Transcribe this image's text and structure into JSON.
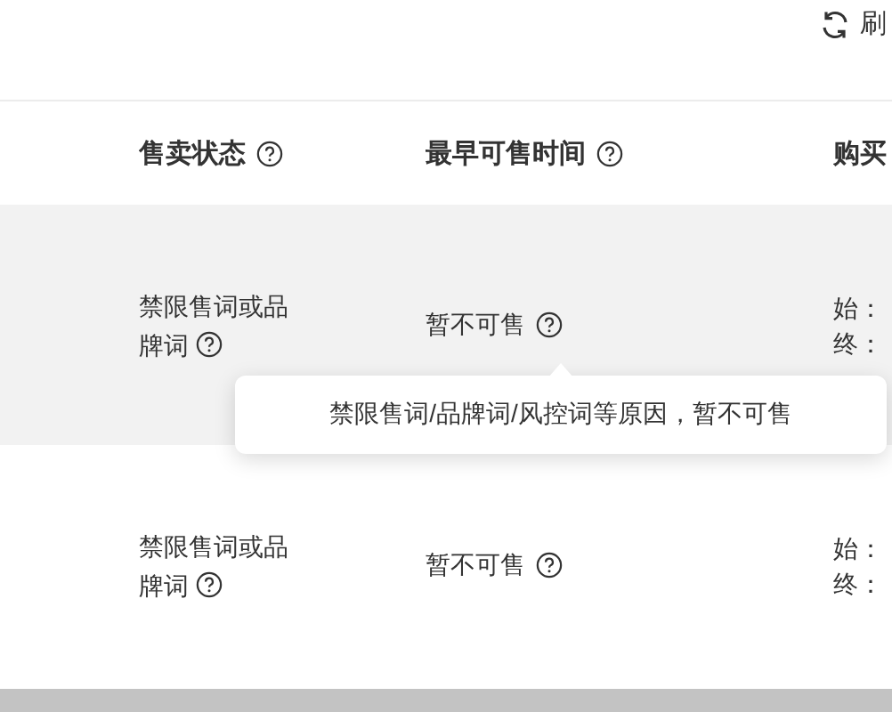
{
  "toolbar": {
    "refresh_label": "刷"
  },
  "table": {
    "columns": [
      {
        "label": "售卖状态",
        "help": true
      },
      {
        "label": "最早可售时间",
        "help": true
      },
      {
        "label": "购买",
        "help": false
      }
    ],
    "rows": [
      {
        "status": "禁限售词或品牌词",
        "status_help": true,
        "time": "暂不可售",
        "time_help": true,
        "period_start": "始：",
        "period_end": "终：",
        "selected": true
      },
      {
        "status": "禁限售词或品牌词",
        "status_help": true,
        "time": "暂不可售",
        "time_help": true,
        "period_start": "始：",
        "period_end": "终：",
        "selected": false
      }
    ]
  },
  "tooltip": {
    "text": "禁限售词/品牌词/风控词等原因，暂不可售"
  }
}
